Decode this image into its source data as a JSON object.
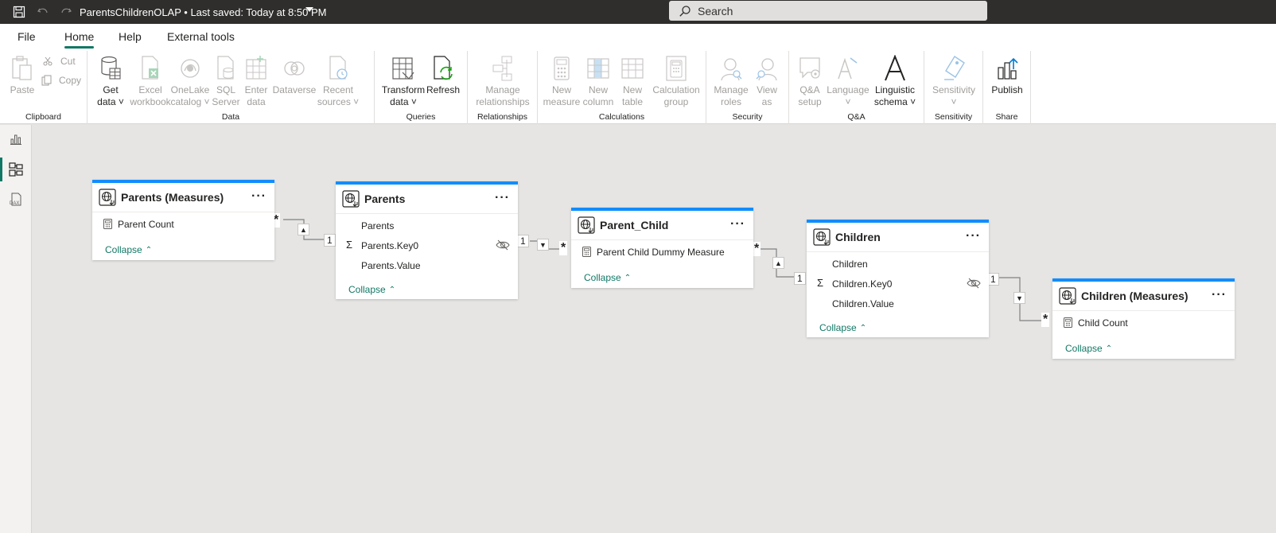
{
  "titlebar": {
    "title": "ParentsChildrenOLAP  •  Last saved: Today at 8:50 PM",
    "search_placeholder": "Search"
  },
  "menu": {
    "tabs": [
      {
        "label": "File"
      },
      {
        "label": "Home"
      },
      {
        "label": "Help"
      },
      {
        "label": "External tools"
      }
    ],
    "active": "Home"
  },
  "ribbon": {
    "clipboard": {
      "label": "Clipboard",
      "paste": "Paste",
      "cut": "Cut",
      "copy": "Copy"
    },
    "data": {
      "label": "Data",
      "get_data": "Get\ndata ˅",
      "excel": "Excel\nworkbook",
      "onelake": "OneLake\ncatalog ˅",
      "sql": "SQL\nServer",
      "enter": "Enter\ndata",
      "dataverse": "Dataverse",
      "recent": "Recent\nsources ˅"
    },
    "queries": {
      "label": "Queries",
      "transform": "Transform\ndata ˅",
      "refresh": "Refresh"
    },
    "relationships": {
      "label": "Relationships",
      "manage": "Manage\nrelationships"
    },
    "calculations": {
      "label": "Calculations",
      "new_measure": "New\nmeasure",
      "new_column": "New\ncolumn",
      "new_table": "New\ntable",
      "calc_group": "Calculation\ngroup"
    },
    "security": {
      "label": "Security",
      "manage_roles": "Manage\nroles",
      "view_as": "View\nas"
    },
    "qa": {
      "label": "Q&A",
      "setup": "Q&A\nsetup",
      "language": "Language\n˅",
      "schema": "Linguistic\nschema ˅"
    },
    "sensitivity": {
      "label": "Sensitivity",
      "btn": "Sensitivity\n˅"
    },
    "share": {
      "label": "Share",
      "publish": "Publish"
    }
  },
  "tables": [
    {
      "title": "Parents (Measures)",
      "fields": [
        {
          "name": "Parent Count",
          "type": "measure"
        }
      ],
      "collapse": "Collapse"
    },
    {
      "title": "Parents",
      "fields": [
        {
          "name": "Parents",
          "type": "plain"
        },
        {
          "name": "Parents.Key0",
          "type": "sum",
          "hidden": true
        },
        {
          "name": "Parents.Value",
          "type": "plain"
        }
      ],
      "collapse": "Collapse"
    },
    {
      "title": "Parent_Child",
      "fields": [
        {
          "name": "Parent Child Dummy Measure",
          "type": "measure"
        }
      ],
      "collapse": "Collapse"
    },
    {
      "title": "Children",
      "fields": [
        {
          "name": "Children",
          "type": "plain"
        },
        {
          "name": "Children.Key0",
          "type": "sum",
          "hidden": true
        },
        {
          "name": "Children.Value",
          "type": "plain"
        }
      ],
      "collapse": "Collapse"
    },
    {
      "title": "Children (Measures)",
      "fields": [
        {
          "name": "Child Count",
          "type": "measure"
        }
      ],
      "collapse": "Collapse"
    }
  ],
  "cardinality": {
    "many": "*",
    "one": "1"
  },
  "colors": {
    "accent": "#117865",
    "table_header_bar": "#118dff",
    "titlebar": "#2f2e2d"
  }
}
